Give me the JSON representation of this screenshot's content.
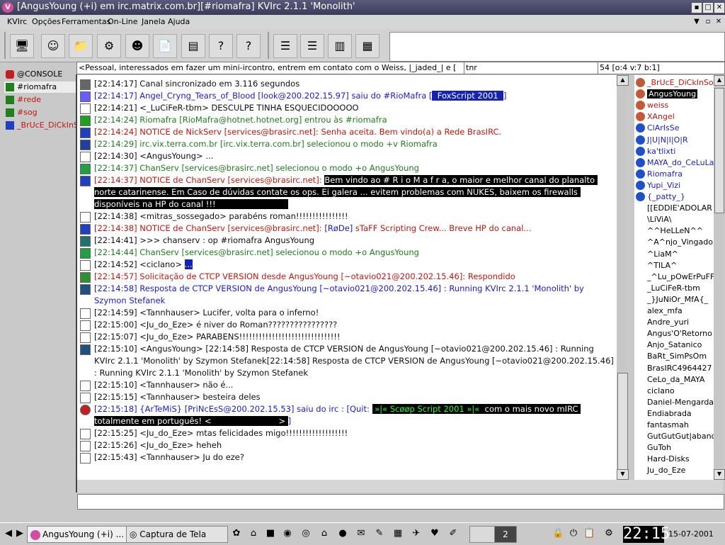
{
  "window": {
    "title": "[AngusYoung (+i) em irc.matrix.com.br][#riomafra] KVIrc 2.1.1 'Monolith'",
    "app_icon": "kvirc-v-icon"
  },
  "menu": [
    "KVIrc",
    "Opções",
    "Ferramentas",
    "On-Line",
    "Janela",
    "Ajuda"
  ],
  "topic": {
    "text": "<Pessoal, interessados em fazer um mini-ircontro, entrem em contato com o Weiss, |_jaded_| e [",
    "extra": "tnr",
    "modes": "54 [o:4 v:7 b:1]"
  },
  "windows": [
    {
      "label": "@CONSOLE",
      "color": "#000000",
      "icon_color": "#c02020"
    },
    {
      "label": "#riomafra",
      "color": "#000000",
      "icon_color": "#208020"
    },
    {
      "label": "#rede",
      "color": "#c0180e",
      "icon_color": "#208020"
    },
    {
      "label": "#sog",
      "color": "#c0180e",
      "icon_color": "#208020"
    },
    {
      "label": "_BrUcE_DiCkInSoN_",
      "color": "#c0180e",
      "icon_color": "#2040c0"
    }
  ],
  "lines": [
    {
      "icon": "arrow-icon",
      "parts": [
        {
          "t": "[22:14:17] Canal sincronizado em 3.116 segundos",
          "c": "dark"
        }
      ]
    },
    {
      "icon": "part-icon",
      "parts": [
        {
          "t": "[22:14:17] Angel_Cryng_Tears_of_Blood [look@200.202.15.97] saiu do #RioMafra [",
          "c": "blue"
        },
        {
          "t": "  FoxScript 2001  ",
          "c": "bluehl"
        },
        {
          "t": "]",
          "c": "blue"
        }
      ]
    },
    {
      "icon": "blank-icon",
      "parts": [
        {
          "t": "[22:14:21] <_LuCiFeR-tbm> DESCULPE TINHA ESQUECIDOOOOO",
          "c": "dark"
        }
      ]
    },
    {
      "icon": "join-icon",
      "parts": [
        {
          "t": "[22:14:24] Riomafra [RioMafra@hotnet.hotnet.org] entrou às #riomafra",
          "c": "green"
        }
      ]
    },
    {
      "icon": "notice-icon",
      "parts": [
        {
          "t": "[22:14:24] NOTICE de NickServ [services@brasirc.net]: Senha aceita. Bem vindo(a) a Rede BrasIRC.",
          "c": "red"
        }
      ]
    },
    {
      "icon": "mode-icon",
      "parts": [
        {
          "t": "[22:14:29] irc.vix.terra.com.br [irc.vix.terra.com.br] selecionou o modo +v Riomafra",
          "c": "green"
        }
      ]
    },
    {
      "icon": "blank-icon",
      "parts": [
        {
          "t": "[22:14:30] <AngusYoung> ...",
          "c": "dark"
        }
      ]
    },
    {
      "icon": "op-icon",
      "parts": [
        {
          "t": "[22:14:37] ChanServ [services@brasirc.net] selecionou o modo +o AngusYoung",
          "c": "green"
        }
      ]
    },
    {
      "icon": "notice-icon",
      "parts": [
        {
          "t": "[22:14:37] NOTICE de ChanServ [services@brasirc.net]: ",
          "c": "red"
        },
        {
          "t": "Bem vindo ao # R i o M a f r a, o maior e melhor canal do planalto norte catarinense. Em Caso de dúvidas contate os ops. Ei galera ... evitem problemas com NUKES, baixem os firewalls disponíveis na HP do canal !!!                            ",
          "c": "hl"
        }
      ]
    },
    {
      "icon": "blank-icon",
      "parts": [
        {
          "t": "[22:14:38] <mitras_sossegado> parabéns roman!!!!!!!!!!!!!!!!",
          "c": "dark"
        }
      ]
    },
    {
      "icon": "notice-icon",
      "parts": [
        {
          "t": "[22:14:38] NOTICE de ChanServ [services@brasirc.net]: ",
          "c": "red"
        },
        {
          "t": "[RøDe]",
          "c": "blue"
        },
        {
          "t": " sTaFF Scripting Crew... Breve HP do canal...",
          "c": "red"
        }
      ]
    },
    {
      "icon": "raw-icon",
      "parts": [
        {
          "t": "[22:14:41] >>> chanserv : op #riomafra AngusYoung",
          "c": "dark"
        }
      ]
    },
    {
      "icon": "op-icon",
      "parts": [
        {
          "t": "[22:14:44] ChanServ [services@brasirc.net] selecionou o modo +o AngusYoung",
          "c": "green"
        }
      ]
    },
    {
      "icon": "blank-icon",
      "parts": [
        {
          "t": "[22:14:52] <ciclano> ",
          "c": "dark"
        },
        {
          "t": "...",
          "c": "bluehl"
        }
      ]
    },
    {
      "icon": "ctcp-icon",
      "parts": [
        {
          "t": "[22:14:57] Solicitação de CTCP VERSION desde AngusYoung [~otavio021@200.202.15.46]: Respondido",
          "c": "red"
        }
      ]
    },
    {
      "icon": "ctcp-reply-icon",
      "parts": [
        {
          "t": "[22:14:58] Resposta de CTCP VERSION de AngusYoung [~otavio021@200.202.15.46] : Running KVIrc 2.1.1 'Monolith' by Szymon Stefanek",
          "c": "blue"
        }
      ]
    },
    {
      "icon": "blank-icon",
      "parts": [
        {
          "t": "[22:14:59] <Tannhauser> Lucifer, volta para o inferno!",
          "c": "dark"
        }
      ]
    },
    {
      "icon": "blank-icon",
      "parts": [
        {
          "t": "[22:15:00] <Ju_do_Eze> é niver do Roman????????????????",
          "c": "dark"
        }
      ]
    },
    {
      "icon": "blank-icon",
      "parts": [
        {
          "t": "[22:15:07] <Ju_do_Eze> PARABENS!!!!!!!!!!!!!!!!!!!!!!!!!!!!!!!",
          "c": "dark"
        }
      ]
    },
    {
      "icon": "ctcp-reply-icon",
      "parts": [
        {
          "t": "[22:15:10] <AngusYoung> [22:14:58] Resposta de CTCP VERSION de AngusYoung [~otavio021@200.202.15.46] : Running KVIrc 2.1.1 'Monolith' by Szymon Stefanek[22:14:58] Resposta de CTCP VERSION de AngusYoung [~otavio021@200.202.15.46] : Running KVIrc 2.1.1 'Monolith' by Szymon Stefanek",
          "c": "dark"
        }
      ]
    },
    {
      "icon": "blank-icon",
      "parts": [
        {
          "t": "[22:15:10] <Tannhauser> não é...",
          "c": "dark"
        }
      ]
    },
    {
      "icon": "blank-icon",
      "parts": [
        {
          "t": "[22:15:15] <Tannhauser> besteira deles",
          "c": "dark"
        }
      ]
    },
    {
      "icon": "quit-icon",
      "parts": [
        {
          "t": "[22:15:18] {ArTeMiS} [PriNcEsS@200.202.15.53] saiu do irc : [Quit: ",
          "c": "blue"
        },
        {
          "t": " »|« Scøøp Script 2001 »|« ",
          "c": "hlg"
        },
        {
          "t": " com o mais novo mIRC totalmente em português! <                          > ",
          "c": "hl"
        },
        {
          "t": "]",
          "c": "blue"
        }
      ]
    },
    {
      "icon": "blank-icon",
      "parts": [
        {
          "t": "[22:15:25] <Ju_do_Eze> mtas felicidades migo!!!!!!!!!!!!!!!!!!!",
          "c": "dark"
        }
      ]
    },
    {
      "icon": "blank-icon",
      "parts": [
        {
          "t": "[22:15:26] <Ju_do_Eze> heheh",
          "c": "dark"
        }
      ]
    },
    {
      "icon": "blank-icon",
      "parts": [
        {
          "t": "[22:15:43] <Tannhauser> Ju do eze?",
          "c": "dark"
        }
      ]
    }
  ],
  "users": [
    {
      "nick": "_BrUcE_DiCkInSoN_",
      "role": "op",
      "color": "#c0180e"
    },
    {
      "nick": "AngusYoung",
      "role": "op",
      "color": "#ffffff",
      "selected": true
    },
    {
      "nick": "weiss",
      "role": "op",
      "color": "#c0180e"
    },
    {
      "nick": "XAngel",
      "role": "op",
      "color": "#c0180e"
    },
    {
      "nick": "ClArIsSe",
      "role": "voice",
      "color": "#1a1ad2"
    },
    {
      "nick": "J|U|N|I|O|R",
      "role": "voice",
      "color": "#1a1ad2"
    },
    {
      "nick": "ka'tlixti",
      "role": "voice",
      "color": "#1a1ad2"
    },
    {
      "nick": "MAYA_do_CeLuLaR",
      "role": "voice",
      "color": "#1a1ad2"
    },
    {
      "nick": "Riomafra",
      "role": "voice",
      "color": "#1a1ad2"
    },
    {
      "nick": "Yupi_Vizi",
      "role": "voice",
      "color": "#1a1ad2"
    },
    {
      "nick": "{_patty_}",
      "role": "voice",
      "color": "#1a1ad2"
    },
    {
      "nick": "[[EDDIE'ADOLAR",
      "role": "",
      "color": "#000000"
    },
    {
      "nick": "\\LiViA\\",
      "role": "",
      "color": "#000000"
    },
    {
      "nick": "^^HeLLeN^^",
      "role": "",
      "color": "#000000"
    },
    {
      "nick": "^A^njo_Vingador",
      "role": "",
      "color": "#000000"
    },
    {
      "nick": "^LiaM^",
      "role": "",
      "color": "#000000"
    },
    {
      "nick": "^TILA^",
      "role": "",
      "color": "#000000"
    },
    {
      "nick": "_^Lu_pOwErPuFF",
      "role": "",
      "color": "#000000"
    },
    {
      "nick": "_LuCiFeR-tbm",
      "role": "",
      "color": "#000000"
    },
    {
      "nick": "_}JuNiOr_MfA{_",
      "role": "",
      "color": "#000000"
    },
    {
      "nick": "alex_mfa",
      "role": "",
      "color": "#000000"
    },
    {
      "nick": "Andre_yuri",
      "role": "",
      "color": "#000000"
    },
    {
      "nick": "Angus'O'Retorno",
      "role": "",
      "color": "#000000"
    },
    {
      "nick": "Anjo_Satanico",
      "role": "",
      "color": "#000000"
    },
    {
      "nick": "BaRt_SimPsOm",
      "role": "",
      "color": "#000000"
    },
    {
      "nick": "BrasIRC4964427",
      "role": "",
      "color": "#000000"
    },
    {
      "nick": "CeLo_da_MAYA",
      "role": "",
      "color": "#000000"
    },
    {
      "nick": "ciclano",
      "role": "",
      "color": "#000000"
    },
    {
      "nick": "Daniel-Mengarda",
      "role": "",
      "color": "#000000"
    },
    {
      "nick": "Endiabrada",
      "role": "",
      "color": "#000000"
    },
    {
      "nick": "fantasmah",
      "role": "",
      "color": "#000000"
    },
    {
      "nick": "GutGutGut|abandoned",
      "role": "",
      "color": "#000000"
    },
    {
      "nick": "GuToh",
      "role": "",
      "color": "#000000"
    },
    {
      "nick": "Hard-Disks",
      "role": "",
      "color": "#000000"
    },
    {
      "nick": "Ju_do_Eze",
      "role": "",
      "color": "#000000"
    }
  ],
  "taskbar": {
    "tasks": [
      "AngusYoung (+i) ...",
      "Captura de Tela"
    ],
    "desktop_number": "2",
    "clock": "22:15",
    "date": "15-07-2001"
  },
  "colors": {
    "accent": "#1522b4",
    "red_text": "#c0180e",
    "green_text": "#1d7d1d",
    "blue_text": "#1a1ad2"
  }
}
